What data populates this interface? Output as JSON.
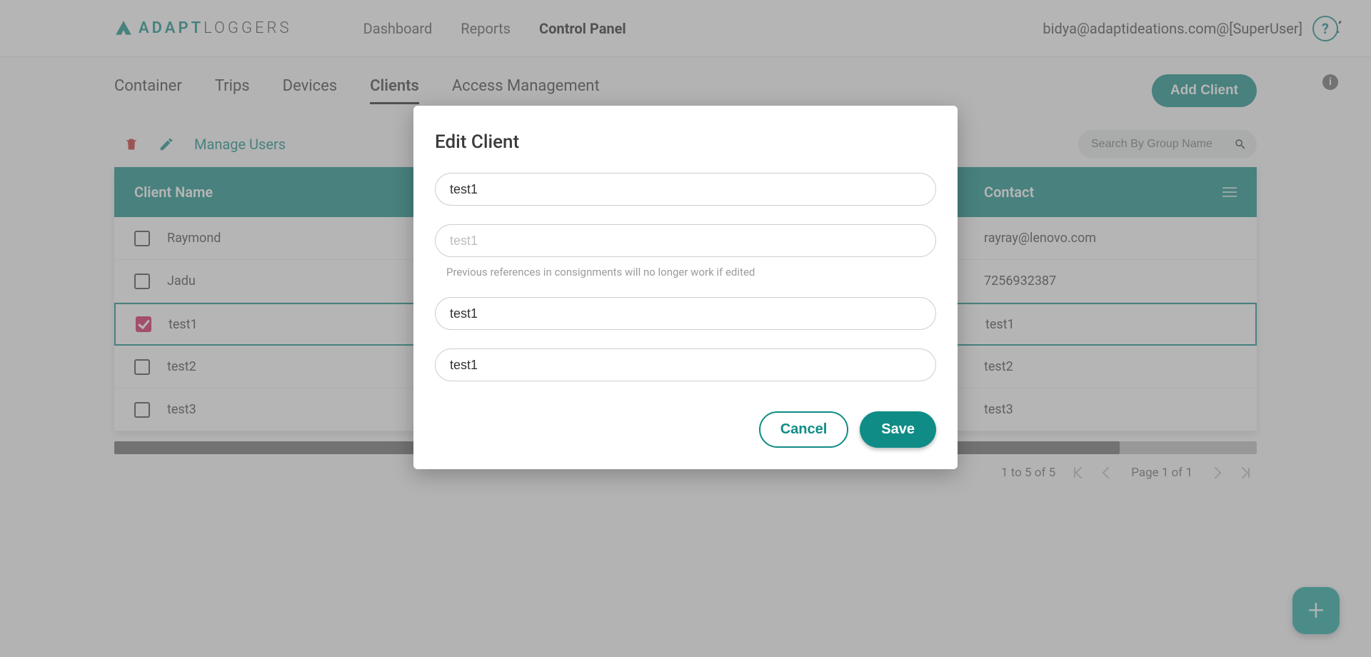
{
  "brand": {
    "name_a": "ADAPT",
    "name_b": "LOGGERS"
  },
  "topnav": {
    "dashboard": "Dashboard",
    "reports": "Reports",
    "control": "Control Panel"
  },
  "user": {
    "label": "bidya@adaptideations.com@[SuperUser]"
  },
  "help": {
    "symbol": "?"
  },
  "info": {
    "symbol": "i"
  },
  "subtabs": {
    "container": "Container",
    "trips": "Trips",
    "devices": "Devices",
    "clients": "Clients",
    "access": "Access Management"
  },
  "buttons": {
    "add_client": "Add Client",
    "manage_users": "Manage Users"
  },
  "search": {
    "placeholder": "Search By Group Name"
  },
  "table": {
    "headers": {
      "name": "Client Name",
      "contact": "Contact"
    },
    "rows": [
      {
        "checked": false,
        "name": "Raymond",
        "contact": "rayray@lenovo.com"
      },
      {
        "checked": false,
        "name": "Jadu",
        "contact": "7256932387"
      },
      {
        "checked": true,
        "name": "test1",
        "contact": "test1"
      },
      {
        "checked": false,
        "name": "test2",
        "contact": "test2"
      },
      {
        "checked": false,
        "name": "test3",
        "contact": "test3"
      }
    ]
  },
  "pager": {
    "range": "1 to 5 of 5",
    "page": "Page 1 of 1"
  },
  "modal": {
    "title": "Edit Client",
    "f1_value": "test1",
    "f2_placeholder": "test1",
    "hint": "Previous references in consignments will no longer work if edited",
    "f3_value": "test1",
    "f4_value": "test1",
    "cancel": "Cancel",
    "save": "Save"
  },
  "fab": {
    "symbol": "+"
  }
}
